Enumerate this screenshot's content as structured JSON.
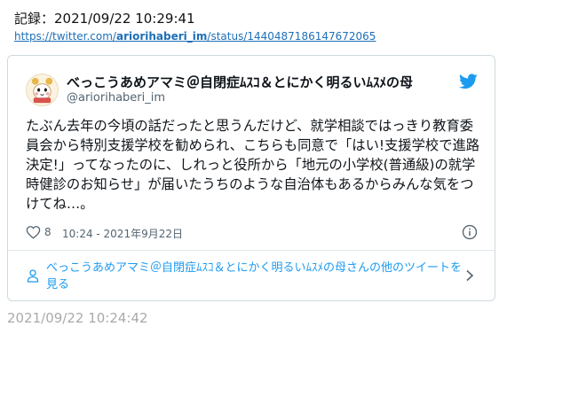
{
  "record": {
    "label": "記録：2021/09/22 10:29:41"
  },
  "source": {
    "url_prefix": "https://twitter.com/",
    "url_user": "ariorihaberi_im",
    "url_suffix": "/status/1440487186147672065"
  },
  "tweet": {
    "author_name": "べっこうあめアマミ＠自閉症ﾑｽｺ＆とにかく明るいﾑｽﾒの母",
    "author_handle": "@ariorihaberi_im",
    "text": "たぶん去年の今頃の話だったと思うんだけど、就学相談ではっきり教育委員会から特別支援学校を勧められ、こちらも同意で「はい!支援学校で進路決定!」ってなったのに、しれっと役所から「地元の小学校(普通級)の就学時健診のお知らせ」が届いたうちのような自治体もあるからみんな気をつけてね…。",
    "likes": "8",
    "time": "10:24 - 2021年9月22日",
    "more_tweets_label": "べっこうあめアマミ＠自閉症ﾑｽｺ＆とにかく明るいﾑｽﾒの母さんの他のツイートを見る"
  },
  "footer": {
    "timestamp": "2021/09/22 10:24:42"
  },
  "colors": {
    "link": "#1d6fb8",
    "twitter_blue": "#1d9bf0",
    "muted": "#536471",
    "border": "#cfd9de"
  },
  "icons": [
    "avatar",
    "twitter-bird-icon",
    "heart-icon",
    "info-icon",
    "person-icon",
    "chevron-right-icon"
  ]
}
